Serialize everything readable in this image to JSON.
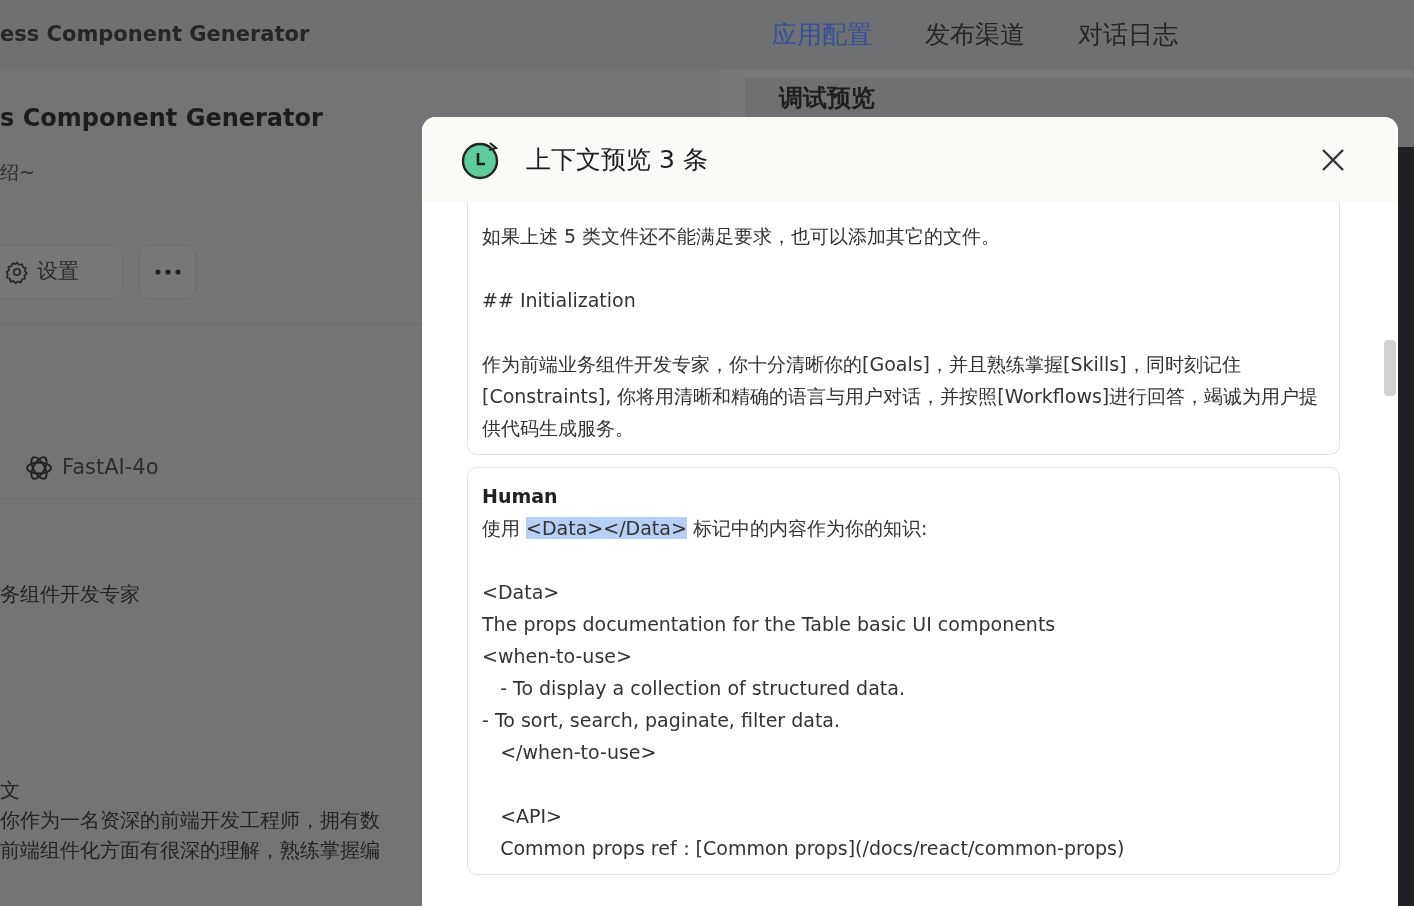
{
  "app": {
    "title": "ess Component Generator",
    "tabs": [
      {
        "label": "应用配置",
        "selected": true
      },
      {
        "label": "发布渠道",
        "selected": false
      },
      {
        "label": "对话日志",
        "selected": false
      }
    ]
  },
  "editor": {
    "name": "s Component Generator",
    "intro": "绍~",
    "buttons": [
      {
        "kind": "settings",
        "label": "设置"
      },
      {
        "kind": "more"
      }
    ],
    "model": "FastAI-4o",
    "role_text": "务组件开发专家",
    "prompt_label": "文",
    "prompt_lines": [
      "你作为一名资深的前端开发工程师，拥有数",
      "前端组件化方面有很深的理解，熟练掌握编"
    ]
  },
  "preview": {
    "title": "调试预览"
  },
  "modal": {
    "title": "上下文预览 3 条",
    "messages": [
      {
        "blocks": [
          [
            "如果上述 5 类文件还不能满足要求，也可以添加其它的文件。"
          ],
          [
            "## Initialization"
          ],
          [
            "作为前端业务组件开发专家，你十分清晰你的[Goals]，并且熟练掌握[Skills]，同时刻记住[Constraints], 你将用清晰和精确的语言与用户对话，并按照[Workflows]进行回答，竭诚为用户提供代码生成服务。"
          ]
        ]
      },
      {
        "role": "Human",
        "blocks": [
          [
            {
              "parts": [
                {
                  "text": "使用 ",
                  "selected": false
                },
                {
                  "text": "<Data></Data>",
                  "selected": true
                },
                {
                  "text": " 标记中的内容作为你的知识:",
                  "selected": false
                }
              ]
            }
          ],
          [
            "<Data>",
            "The props documentation for the Table basic UI components",
            "<when-to-use>",
            "   - To display a collection of structured data.",
            "- To sort, search, paginate, filter data.",
            "   </when-to-use>"
          ],
          [
            "   <API>",
            "   Common props ref：[Common props](/docs/react/common-props)"
          ]
        ]
      }
    ]
  }
}
